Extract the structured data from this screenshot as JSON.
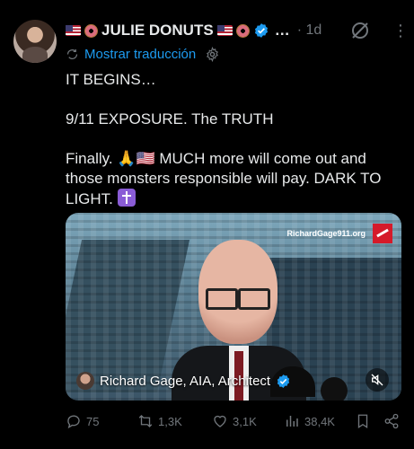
{
  "tweet": {
    "display_name": "JULIE DONUTS",
    "name_suffix": "…",
    "timestamp": "· 1d",
    "translate_label": "Mostrar traducción",
    "lines": [
      "IT BEGINS…",
      "9/11 EXPOSURE. The TRUTH",
      "Finally. 🙏🇺🇸 MUCH more will come out and those monsters responsible will pay. DARK TO LIGHT."
    ]
  },
  "media": {
    "watermark": "RichardGage911.org",
    "caption": "Richard Gage, AIA, Architect"
  },
  "actions": {
    "replies": "75",
    "reposts": "1,3K",
    "likes": "3,1K",
    "views": "38,4K"
  },
  "colors": {
    "background": "#000000",
    "text": "#e7e9ea",
    "muted": "#71767b",
    "accent": "#1d9bf0"
  }
}
